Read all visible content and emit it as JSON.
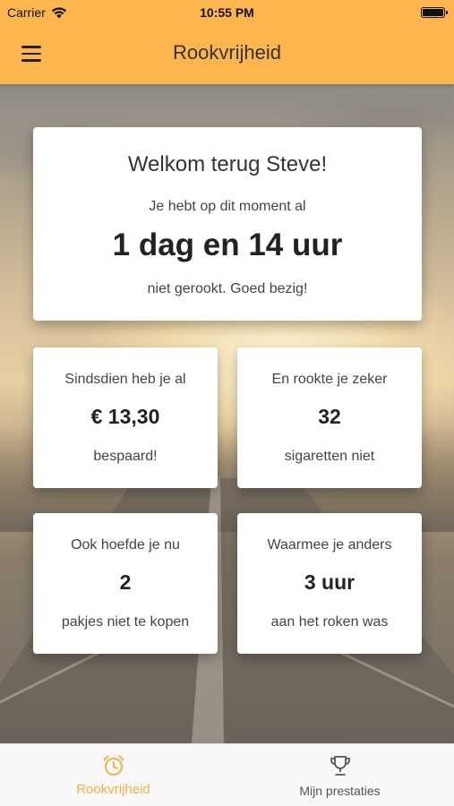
{
  "status_bar": {
    "carrier": "Carrier",
    "time": "10:55 PM"
  },
  "header": {
    "title": "Rookvrijheid",
    "menu_icon": "hamburger-menu-icon"
  },
  "welcome": {
    "greeting": "Welkom terug Steve!",
    "pre_text": "Je hebt op dit moment al",
    "duration": "1 dag en 14 uur",
    "post_text": "niet gerookt. Goed bezig!"
  },
  "stats": [
    {
      "top": "Sindsdien heb je al",
      "value": "€ 13,30",
      "bottom": "bespaard!"
    },
    {
      "top": "En rookte je zeker",
      "value": "32",
      "bottom": "sigaretten niet"
    },
    {
      "top": "Ook hoefde je nu",
      "value": "2",
      "bottom": "pakjes niet te kopen"
    },
    {
      "top": "Waarmee je anders",
      "value": "3 uur",
      "bottom": "aan het roken was"
    }
  ],
  "tabbar": {
    "tabs": [
      {
        "label": "Rookvrijheid",
        "icon": "alarm-clock-icon",
        "active": true
      },
      {
        "label": "Mijn prestaties",
        "icon": "trophy-icon",
        "active": false
      }
    ]
  },
  "colors": {
    "accent": "#fdb64d",
    "active_tab": "#f5b041",
    "card_bg": "#ffffff"
  }
}
